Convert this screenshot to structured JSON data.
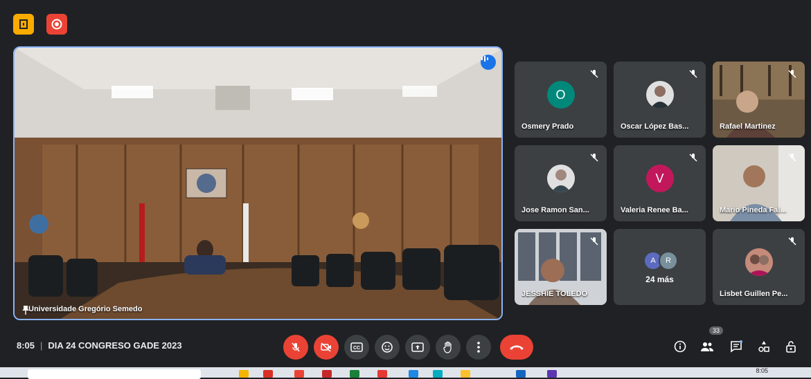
{
  "meeting": {
    "time": "8:05",
    "title": "DIA 24 CONGRESO GADE 2023"
  },
  "main_video": {
    "label": "Universidade Gregório Semedo"
  },
  "participants": [
    {
      "name": "Osmery Prado",
      "initial": "O",
      "color": "#00897b",
      "type": "initial"
    },
    {
      "name": "Oscar López Bas...",
      "type": "avatar"
    },
    {
      "name": "Rafael Martinez",
      "type": "video"
    },
    {
      "name": "Jose Ramon San...",
      "type": "avatar"
    },
    {
      "name": "Valeria Renee Ba...",
      "initial": "V",
      "color": "#c2185b",
      "type": "initial"
    },
    {
      "name": "Mario Pineda Fal...",
      "type": "video"
    },
    {
      "name": "JESSHIE TOLEDO",
      "type": "video"
    },
    {
      "name": "Lisbet Guillen Pe...",
      "type": "avatar"
    }
  ],
  "more_tile": {
    "label": "24 más",
    "initials": [
      "A",
      "R"
    ],
    "colors": [
      "#5c6bc0",
      "#78909c"
    ]
  },
  "people_count": "33",
  "taskbar": {
    "time": "8:05"
  },
  "icons": {
    "top_left": [
      "door-icon",
      "record-icon"
    ],
    "controls": [
      "mic-off-icon",
      "camera-off-icon",
      "captions-icon",
      "emoji-icon",
      "present-icon",
      "raise-hand-icon",
      "more-options-icon",
      "end-call-icon"
    ],
    "right": [
      "info-icon",
      "people-icon",
      "chat-icon",
      "activities-icon",
      "host-controls-icon"
    ]
  }
}
